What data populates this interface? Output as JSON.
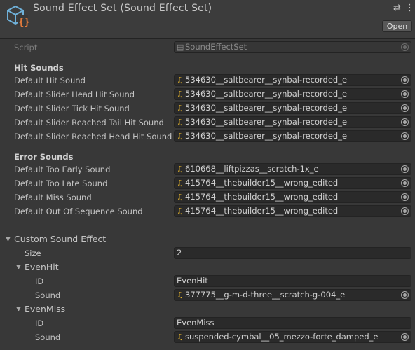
{
  "header": {
    "title": "Sound Effect Set (Sound Effect Set)",
    "open_label": "Open",
    "settings_glyph": "⇄",
    "menu_glyph": "⋮"
  },
  "script": {
    "label": "Script",
    "value": "SoundEffectSet"
  },
  "hit_sounds": {
    "heading": "Hit Sounds",
    "items": [
      {
        "label": "Default Hit Sound",
        "value": "534630__saltbearer__synbal-recorded_e"
      },
      {
        "label": "Default Slider Head Hit Sound",
        "value": "534630__saltbearer__synbal-recorded_e"
      },
      {
        "label": "Default Slider Tick Hit Sound",
        "value": "534630__saltbearer__synbal-recorded_e"
      },
      {
        "label": "Default Slider Reached Tail Hit Sound",
        "value": "534630__saltbearer__synbal-recorded_e"
      },
      {
        "label": "Default Slider Reached Head Hit Sound",
        "value": "534630__saltbearer__synbal-recorded_e"
      }
    ]
  },
  "error_sounds": {
    "heading": "Error Sounds",
    "items": [
      {
        "label": "Default Too Early Sound",
        "value": "610668__liftpizzas__scratch-1x_e"
      },
      {
        "label": "Default Too Late Sound",
        "value": "415764__thebuilder15__wrong_edited"
      },
      {
        "label": "Default Miss Sound",
        "value": "415764__thebuilder15__wrong_edited"
      },
      {
        "label": "Default Out Of Sequence Sound",
        "value": "415764__thebuilder15__wrong_edited"
      }
    ]
  },
  "custom": {
    "heading": "Custom Sound Effect",
    "size_label": "Size",
    "size_value": "2",
    "elements": [
      {
        "name": "EvenHit",
        "id_label": "ID",
        "id_value": "EvenHit",
        "sound_label": "Sound",
        "sound_value": "377775__g-m-d-three__scratch-g-004_e"
      },
      {
        "name": "EvenMiss",
        "id_label": "ID",
        "id_value": "EvenMiss",
        "sound_label": "Sound",
        "sound_value": "suspended-cymbal__05_mezzo-forte_damped_e"
      }
    ]
  },
  "colors": {
    "background": "#383838",
    "header": "#3c3c3c",
    "field": "#2a2a2a",
    "audio_icon": "#e0b02c"
  }
}
